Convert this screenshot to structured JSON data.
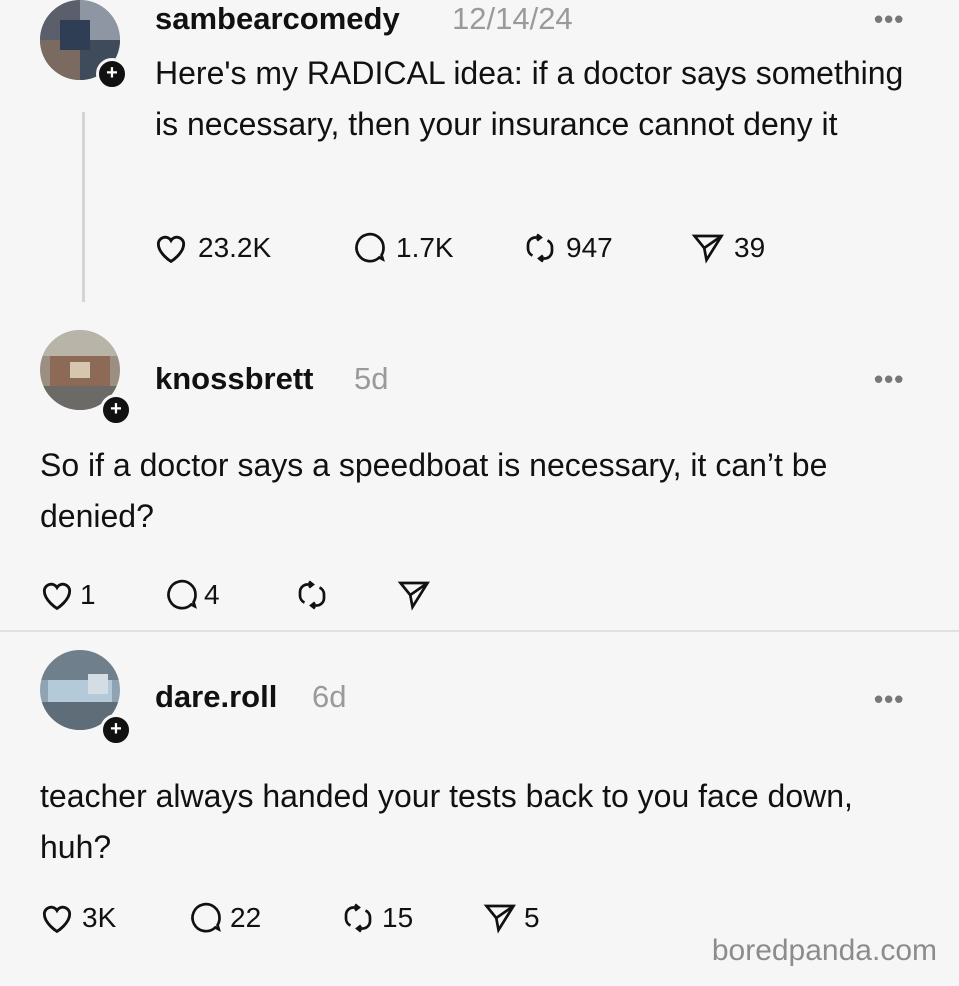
{
  "posts": [
    {
      "username": "sambearcomedy",
      "time": "12/14/24",
      "text": "Here's my RADICAL idea: if a doctor says something is necessary, then your  insurance cannot deny it",
      "likes": "23.2K",
      "replies": "1.7K",
      "reposts": "947",
      "shares": "39"
    },
    {
      "username": "knossbrett",
      "time": "5d",
      "text": "So if a doctor says a speedboat is necessary, it can’t be denied?",
      "likes": "1",
      "replies": "4",
      "reposts": "",
      "shares": ""
    },
    {
      "username": "dare.roll",
      "time": "6d",
      "text": "teacher always handed your tests back to you face down, huh?",
      "likes": "3K",
      "replies": "22",
      "reposts": "15",
      "shares": "5"
    }
  ],
  "ui": {
    "more": "•••",
    "follow_plus": "+"
  },
  "watermark": "boredpanda.com",
  "icons": [
    "heart-icon",
    "comment-icon",
    "repost-icon",
    "share-icon",
    "more-icon",
    "follow-plus-icon"
  ]
}
